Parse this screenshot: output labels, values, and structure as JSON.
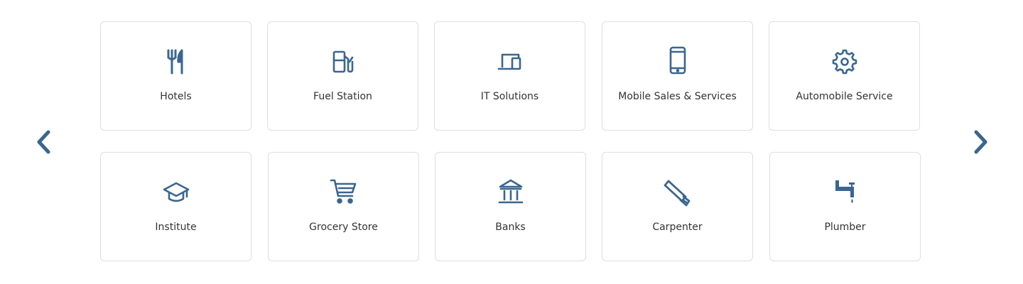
{
  "colors": {
    "accent": "#3a6690",
    "text": "#333333",
    "border": "#dedede"
  },
  "navigation": {
    "prev_icon": "chevron-left-icon",
    "next_icon": "chevron-right-icon"
  },
  "categories": [
    {
      "label": "Hotels",
      "icon": "fork-knife-icon"
    },
    {
      "label": "Fuel Station",
      "icon": "fuel-pump-icon"
    },
    {
      "label": "IT Solutions",
      "icon": "devices-icon"
    },
    {
      "label": "Mobile Sales & Services",
      "icon": "mobile-phone-icon"
    },
    {
      "label": "Automobile Service",
      "icon": "gear-icon"
    },
    {
      "label": "Institute",
      "icon": "graduation-cap-icon"
    },
    {
      "label": "Grocery Store",
      "icon": "shopping-cart-icon"
    },
    {
      "label": "Banks",
      "icon": "bank-icon"
    },
    {
      "label": "Carpenter",
      "icon": "saw-icon"
    },
    {
      "label": "Plumber",
      "icon": "faucet-icon"
    }
  ]
}
